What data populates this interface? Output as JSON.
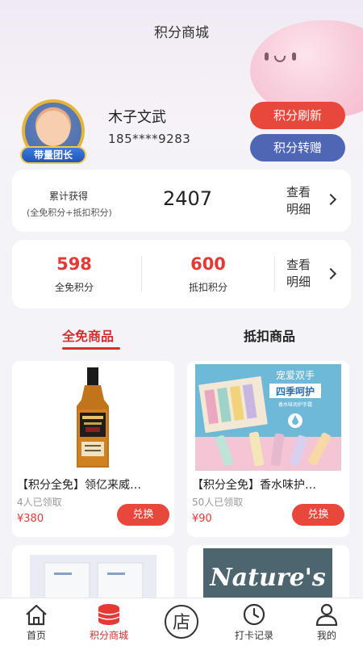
{
  "header": {
    "title": "积分商城"
  },
  "user": {
    "name": "木子文武",
    "phone": "185****9283",
    "badge": "带量团长"
  },
  "actions": {
    "refresh_label": "积分刷新",
    "transfer_label": "积分转赠"
  },
  "cumulative": {
    "label": "累计获得",
    "sub": "(全免积分+抵扣积分)",
    "value": "2407",
    "detail_label": "查看明细"
  },
  "points": {
    "free": {
      "value": "598",
      "label": "全免积分"
    },
    "deduct": {
      "value": "600",
      "label": "抵扣积分"
    },
    "detail_label": "查看明细"
  },
  "tabs": [
    {
      "label": "全免商品",
      "active": true
    },
    {
      "label": "抵扣商品",
      "active": false
    }
  ],
  "products": [
    {
      "title": "【积分全免】领亿来威…",
      "claimed": "4人已领取",
      "price": "¥380",
      "button": "兑换",
      "image": "whisky-bottle"
    },
    {
      "title": "【积分全免】香水味护…",
      "claimed": "50人已领取",
      "price": "¥90",
      "button": "兑换",
      "image": "hand-cream-set",
      "image_text_1": "宠爱双手",
      "image_text_2": "四季呵护",
      "image_text_3": "香水味润护手霜"
    }
  ],
  "partial_product": {
    "image_text": "Nature's"
  },
  "tabbar": [
    {
      "label": "首页",
      "icon": "home-icon",
      "active": false
    },
    {
      "label": "积分商城",
      "icon": "coins-icon",
      "active": true
    },
    {
      "label": "店",
      "icon": "store-icon",
      "active": false
    },
    {
      "label": "打卡记录",
      "icon": "clock-icon",
      "active": false
    },
    {
      "label": "我的",
      "icon": "person-icon",
      "active": false
    }
  ],
  "colors": {
    "accent": "#e8473b",
    "secondary": "#4f66b5",
    "price": "#e53935"
  }
}
